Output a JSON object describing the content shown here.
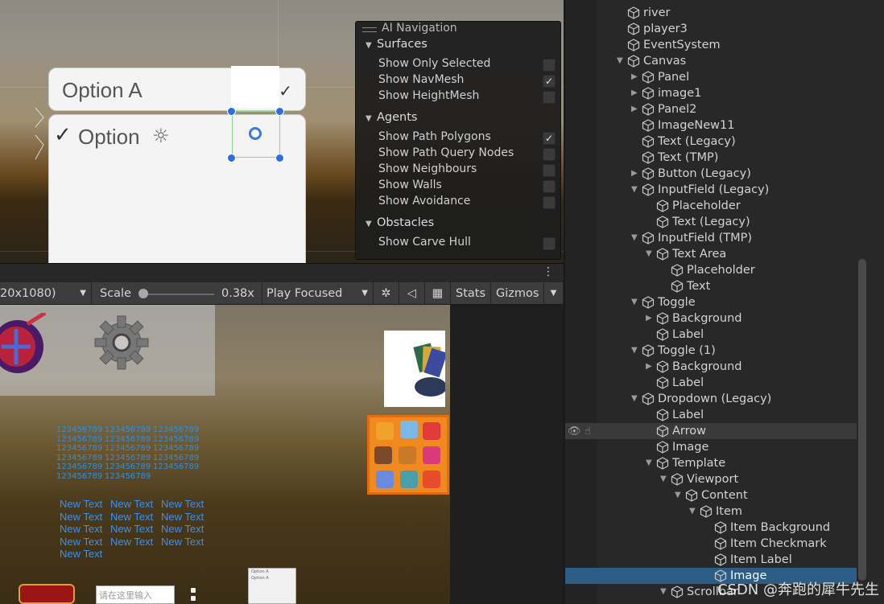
{
  "scene": {
    "dropdown_label": "Option A",
    "dropdown_item_label": "Option",
    "ai_nav": {
      "title": "AI Navigation",
      "sections": [
        {
          "title": "Surfaces",
          "rows": [
            {
              "label": "Show Only Selected",
              "checked": false
            },
            {
              "label": "Show NavMesh",
              "checked": true
            },
            {
              "label": "Show HeightMesh",
              "checked": false
            }
          ]
        },
        {
          "title": "Agents",
          "rows": [
            {
              "label": "Show Path Polygons",
              "checked": true
            },
            {
              "label": "Show Path Query Nodes",
              "checked": false
            },
            {
              "label": "Show Neighbours",
              "checked": false
            },
            {
              "label": "Show Walls",
              "checked": false
            },
            {
              "label": "Show Avoidance",
              "checked": false
            }
          ]
        },
        {
          "title": "Obstacles",
          "rows": [
            {
              "label": "Show Carve Hull",
              "checked": false
            }
          ]
        }
      ]
    }
  },
  "game_toolbar": {
    "resolution": "20x1080)",
    "scale_label": "Scale",
    "scale_value": "0.38x",
    "play_mode": "Play Focused",
    "stats": "Stats",
    "gizmos": "Gizmos"
  },
  "game": {
    "numbers": [
      [
        "123456789",
        "123456789",
        "123456789"
      ],
      [
        "123456789",
        "123456789",
        "123456789"
      ],
      [
        "123456789",
        "123456789",
        "123456789"
      ],
      [
        "123456789",
        "123456789",
        "123456789"
      ],
      [
        "123456789",
        "123456789",
        "123456789"
      ],
      [
        "123456789",
        "123456789"
      ]
    ],
    "texts": [
      [
        "New Text",
        "New Text",
        "New Text"
      ],
      [
        "New Text",
        "New Text",
        "New Text"
      ],
      [
        "New Text",
        "New Text",
        "New Text"
      ],
      [
        "New Text",
        "New Text",
        "New Text"
      ],
      [
        "New Text"
      ]
    ],
    "input_placeholder": "请在这里输入",
    "mini_dropdown": [
      "Option A",
      "Option A"
    ]
  },
  "hierarchy": {
    "items": [
      {
        "name": "river",
        "depth": 0,
        "fold": ""
      },
      {
        "name": "player3",
        "depth": 0,
        "fold": ""
      },
      {
        "name": "EventSystem",
        "depth": 0,
        "fold": ""
      },
      {
        "name": "Canvas",
        "depth": 0,
        "fold": "open"
      },
      {
        "name": "Panel",
        "depth": 1,
        "fold": "closed"
      },
      {
        "name": "image1",
        "depth": 1,
        "fold": "closed"
      },
      {
        "name": "Panel2",
        "depth": 1,
        "fold": "closed"
      },
      {
        "name": "ImageNew11",
        "depth": 1,
        "fold": ""
      },
      {
        "name": "Text (Legacy)",
        "depth": 1,
        "fold": ""
      },
      {
        "name": "Text (TMP)",
        "depth": 1,
        "fold": ""
      },
      {
        "name": "Button (Legacy)",
        "depth": 1,
        "fold": "closed"
      },
      {
        "name": "InputField (Legacy)",
        "depth": 1,
        "fold": "open"
      },
      {
        "name": "Placeholder",
        "depth": 2,
        "fold": ""
      },
      {
        "name": "Text (Legacy)",
        "depth": 2,
        "fold": ""
      },
      {
        "name": "InputField (TMP)",
        "depth": 1,
        "fold": "open"
      },
      {
        "name": "Text Area",
        "depth": 2,
        "fold": "open"
      },
      {
        "name": "Placeholder",
        "depth": 3,
        "fold": ""
      },
      {
        "name": "Text",
        "depth": 3,
        "fold": ""
      },
      {
        "name": "Toggle",
        "depth": 1,
        "fold": "open"
      },
      {
        "name": "Background",
        "depth": 2,
        "fold": "closed"
      },
      {
        "name": "Label",
        "depth": 2,
        "fold": ""
      },
      {
        "name": "Toggle (1)",
        "depth": 1,
        "fold": "open"
      },
      {
        "name": "Background",
        "depth": 2,
        "fold": "closed"
      },
      {
        "name": "Label",
        "depth": 2,
        "fold": ""
      },
      {
        "name": "Dropdown (Legacy)",
        "depth": 1,
        "fold": "open"
      },
      {
        "name": "Label",
        "depth": 2,
        "fold": ""
      },
      {
        "name": "Arrow",
        "depth": 2,
        "fold": "",
        "state": "hover"
      },
      {
        "name": "Image",
        "depth": 2,
        "fold": ""
      },
      {
        "name": "Template",
        "depth": 2,
        "fold": "open"
      },
      {
        "name": "Viewport",
        "depth": 3,
        "fold": "open"
      },
      {
        "name": "Content",
        "depth": 4,
        "fold": "open"
      },
      {
        "name": "Item",
        "depth": 5,
        "fold": "open"
      },
      {
        "name": "Item Background",
        "depth": 6,
        "fold": ""
      },
      {
        "name": "Item Checkmark",
        "depth": 6,
        "fold": ""
      },
      {
        "name": "Item Label",
        "depth": 6,
        "fold": ""
      },
      {
        "name": "Image",
        "depth": 6,
        "fold": "",
        "state": "selected"
      },
      {
        "name": "Scrollbar",
        "depth": 3,
        "fold": "open"
      }
    ],
    "watermark": "CSDN @奔跑的犀牛先生"
  }
}
